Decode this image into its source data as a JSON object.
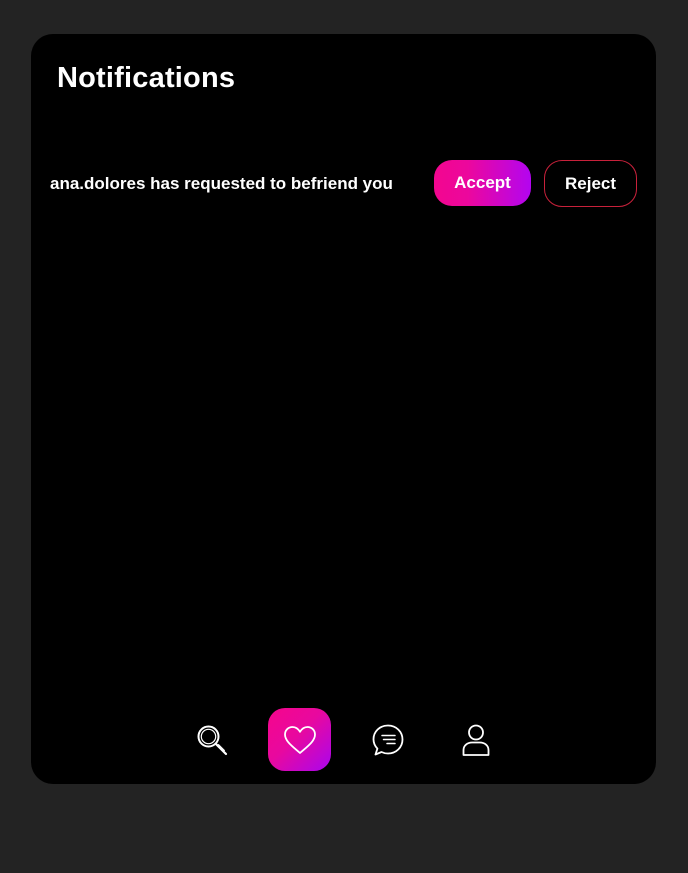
{
  "page": {
    "title": "Notifications"
  },
  "notifications": [
    {
      "text": "ana.dolores has requested to befriend you",
      "accept_label": "Accept",
      "reject_label": "Reject"
    }
  ],
  "navbar": {
    "items": [
      {
        "icon": "search-icon",
        "active": false
      },
      {
        "icon": "heart-icon",
        "active": true
      },
      {
        "icon": "chat-icon",
        "active": false
      },
      {
        "icon": "user-icon",
        "active": false
      }
    ]
  },
  "colors": {
    "background": "#232323",
    "card": "#000000",
    "accent_start": "#f3068f",
    "accent_end": "#b305f0",
    "reject_border": "#c8213b",
    "text": "#ffffff"
  }
}
